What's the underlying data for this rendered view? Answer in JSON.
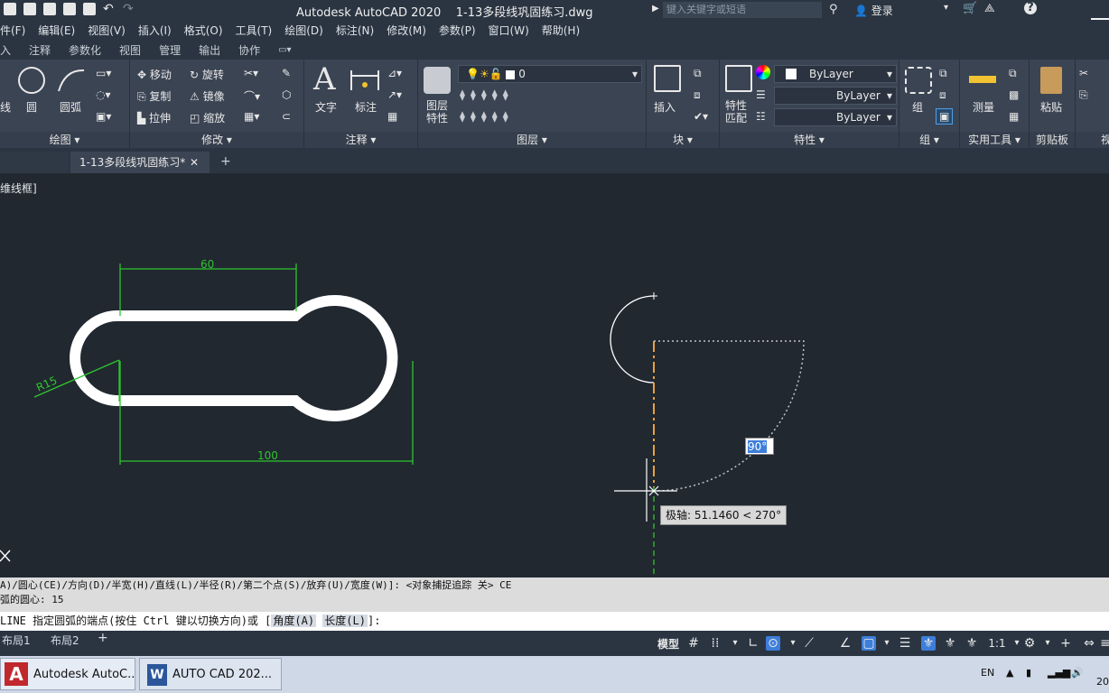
{
  "title_bar": {
    "app_title": "Autodesk AutoCAD 2020",
    "file_name": "1-13多段线巩固练习.dwg",
    "search_placeholder": "键入关键字或短语",
    "login_label": "登录"
  },
  "menu": [
    "件(F)",
    "编辑(E)",
    "视图(V)",
    "插入(I)",
    "格式(O)",
    "工具(T)",
    "绘图(D)",
    "标注(N)",
    "修改(M)",
    "参数(P)",
    "窗口(W)",
    "帮助(H)"
  ],
  "ribbon_tabs": [
    "入",
    "注释",
    "参数化",
    "视图",
    "管理",
    "输出",
    "协作"
  ],
  "ribbon": {
    "draw": {
      "line": "线",
      "circle": "圆",
      "arc": "圆弧",
      "panel": "绘图"
    },
    "modify": {
      "move": "移动",
      "rotate": "旋转",
      "copy": "复制",
      "mirror": "镜像",
      "stretch": "拉伸",
      "scale": "缩放",
      "panel": "修改"
    },
    "annotation": {
      "text": "文字",
      "dimension": "标注",
      "panel": "注释"
    },
    "layers": {
      "properties": "图层\n特性",
      "current_layer": "0",
      "panel": "图层"
    },
    "block": {
      "insert": "插入",
      "panel": "块"
    },
    "properties": {
      "match": "特性\n匹配",
      "color": "ByLayer",
      "linetype": "ByLayer",
      "lineweight": "ByLayer",
      "panel": "特性"
    },
    "groups": {
      "group": "组",
      "panel": "组"
    },
    "utilities": {
      "measure": "测量",
      "panel": "实用工具"
    },
    "clipboard": {
      "paste": "粘贴",
      "panel": "剪贴板"
    },
    "view_partial": "视"
  },
  "doc_tab": {
    "label": "1-13多段线巩固练习*"
  },
  "viewport_label": "维线框]",
  "drawing": {
    "dim_top": "60",
    "dim_bottom": "100",
    "dim_radius": "R15",
    "angle_input": "90°",
    "polar_tooltip": "极轴: 51.1460 < 270°"
  },
  "command": {
    "history_line1": "A)/圆心(CE)/方向(D)/半宽(H)/直线(L)/半径(R)/第二个点(S)/放弃(U)/宽度(W)]:  <对象捕捉追踪 关> CE",
    "history_line2": "弧的圆心: 15",
    "prompt_prefix": "LINE 指定圆弧的端点(按住 Ctrl 键以切换方向)或 [",
    "option_angle": "角度(A)",
    "option_length": "长度(L)",
    "prompt_suffix": "]:"
  },
  "layout_tabs": [
    "布局1",
    "布局2"
  ],
  "status": {
    "model": "模型",
    "scale": "1:1"
  },
  "taskbar": {
    "task1": "Autodesk AutoC...",
    "task2": "AUTO  CAD 202...",
    "lang": "EN",
    "clock_partial": "20"
  }
}
